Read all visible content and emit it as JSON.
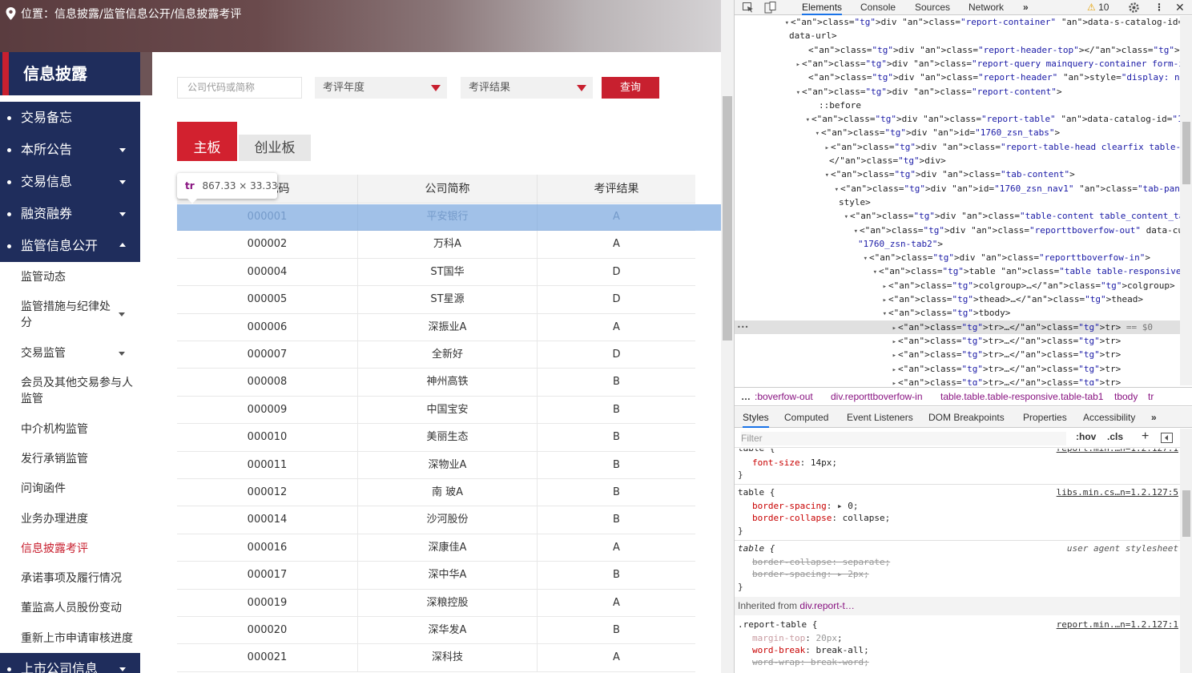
{
  "site": {
    "location_label": "位置：信息披露/监管信息公开/信息披露考评",
    "sidebar_title": "信息披露",
    "main_nav": [
      {
        "label": "交易备忘",
        "caret": "none"
      },
      {
        "label": "本所公告",
        "caret": "down"
      },
      {
        "label": "交易信息",
        "caret": "down"
      },
      {
        "label": "融资融券",
        "caret": "down"
      },
      {
        "label": "监管信息公开",
        "caret": "up"
      }
    ],
    "sub_nav": [
      "监管动态",
      "监管措施与纪律处分",
      "交易监管",
      "会员及其他交易参与人监管",
      "中介机构监管",
      "发行承销监管",
      "问询函件",
      "业务办理进度",
      "信息披露考评",
      "承诺事项及履行情况",
      "董监高人员股份变动",
      "重新上市申请审核进度"
    ],
    "bottom_nav": "上市公司信息",
    "query": {
      "company_placeholder": "公司代码或简称",
      "year_select": "考评年度",
      "result_select": "考评结果",
      "button": "查询"
    },
    "tabs": [
      "主板",
      "创业板"
    ],
    "table": {
      "headers": [
        "公司代码",
        "公司简称",
        "考评结果"
      ],
      "rows": [
        [
          "000001",
          "平安银行",
          "A"
        ],
        [
          "000002",
          "万科A",
          "A"
        ],
        [
          "000004",
          "ST国华",
          "D"
        ],
        [
          "000005",
          "ST星源",
          "D"
        ],
        [
          "000006",
          "深振业A",
          "A"
        ],
        [
          "000007",
          "全新好",
          "D"
        ],
        [
          "000008",
          "神州高铁",
          "B"
        ],
        [
          "000009",
          "中国宝安",
          "B"
        ],
        [
          "000010",
          "美丽生态",
          "B"
        ],
        [
          "000011",
          "深物业A",
          "B"
        ],
        [
          "000012",
          "南 玻A",
          "B"
        ],
        [
          "000014",
          "沙河股份",
          "B"
        ],
        [
          "000016",
          "深康佳A",
          "A"
        ],
        [
          "000017",
          "深中华A",
          "B"
        ],
        [
          "000019",
          "深粮控股",
          "A"
        ],
        [
          "000020",
          "深华发A",
          "B"
        ],
        [
          "000021",
          "深科技",
          "A"
        ]
      ]
    },
    "tooltip": {
      "tag": "tr",
      "size": "867.33 × 33.33"
    }
  },
  "devtools": {
    "tabs": [
      "Elements",
      "Console",
      "Sources",
      "Network"
    ],
    "warning_count": "10",
    "breadcrumbs": [
      "…",
      ":boverfow-out",
      "div.reporttboverfow-in",
      "table.table.table-responsive.table-tab1",
      "tbody",
      "tr"
    ],
    "style_tabs": [
      "Styles",
      "Computed",
      "Event Listeners",
      "DOM Breakpoints",
      "Properties",
      "Accessibility"
    ],
    "filter_placeholder": "Filter",
    "hov": ":hov",
    "cls": ".cls",
    "inherited_label": "Inherited from",
    "inherited_ref": "div.report-t…"
  },
  "colors": {
    "brand_red": "#c8202f",
    "nav_navy": "#1f2d5c",
    "highlight": "#6fa0dc"
  }
}
